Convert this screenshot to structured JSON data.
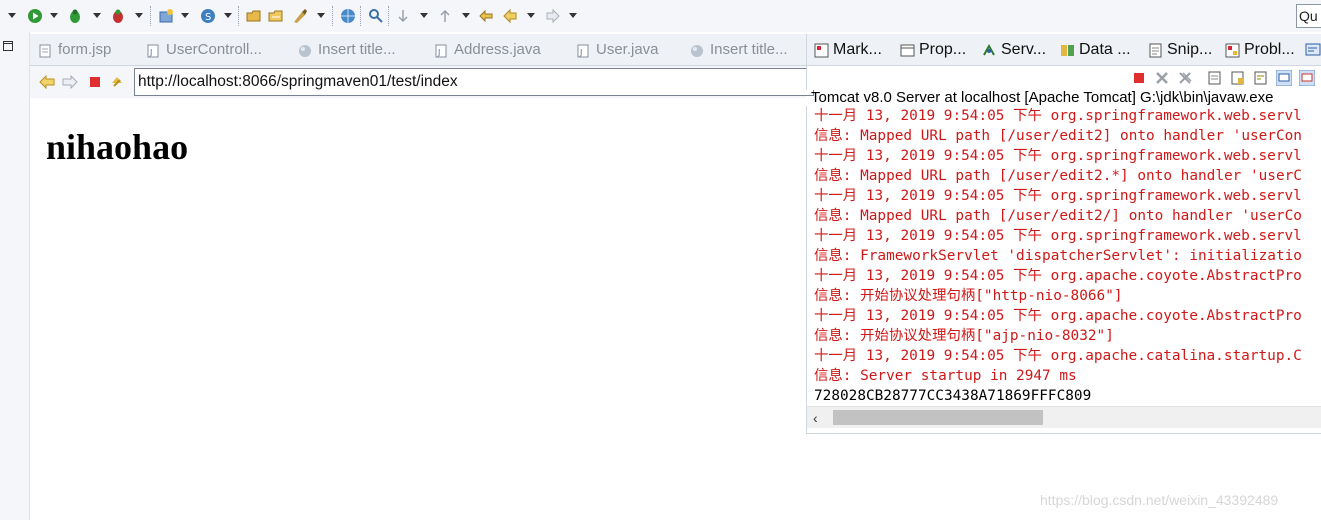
{
  "toolbar": {
    "icons": [
      "new-wizard",
      "run",
      "debug",
      "coverage",
      "external-tools",
      "new-project",
      "new-server",
      "open-type",
      "open-resource",
      "deploy",
      "web-browser",
      "search",
      "next-annotation",
      "prev-annotation",
      "last-edit",
      "back",
      "forward"
    ],
    "quick_access": "Qu"
  },
  "editor": {
    "tabs": [
      {
        "label": "form.jsp",
        "icon": "jsp-file-icon"
      },
      {
        "label": "UserControll...",
        "icon": "java-file-icon"
      },
      {
        "label": "Insert title...",
        "icon": "globe-icon"
      },
      {
        "label": "Address.java",
        "icon": "java-file-icon"
      },
      {
        "label": "User.java",
        "icon": "java-file-icon"
      },
      {
        "label": "Insert title...",
        "icon": "globe-icon"
      }
    ],
    "browser": {
      "url": "http://localhost:8066/springmaven01/test/index"
    },
    "page_heading": "nihaohao"
  },
  "views": {
    "tabs": [
      {
        "label": "Mark...",
        "icon": "markers-icon"
      },
      {
        "label": "Prop...",
        "icon": "properties-icon"
      },
      {
        "label": "Serv...",
        "icon": "servers-icon"
      },
      {
        "label": "Data ...",
        "icon": "data-source-icon"
      },
      {
        "label": "Snip...",
        "icon": "snippets-icon"
      },
      {
        "label": "Probl...",
        "icon": "problems-icon"
      }
    ]
  },
  "console": {
    "label": "Tomcat v8.0 Server at localhost [Apache Tomcat] G:\\jdk\\bin\\javaw.exe",
    "lines": [
      {
        "text": "十一月 13, 2019 9:54:05 下午 org.springframework.web.servl",
        "color": "red"
      },
      {
        "text": "信息: Mapped URL path [/user/edit2] onto handler 'userCon",
        "color": "red"
      },
      {
        "text": "十一月 13, 2019 9:54:05 下午 org.springframework.web.servl",
        "color": "red"
      },
      {
        "text": "信息: Mapped URL path [/user/edit2.*] onto handler 'userC",
        "color": "red"
      },
      {
        "text": "十一月 13, 2019 9:54:05 下午 org.springframework.web.servl",
        "color": "red"
      },
      {
        "text": "信息: Mapped URL path [/user/edit2/] onto handler 'userCo",
        "color": "red"
      },
      {
        "text": "十一月 13, 2019 9:54:05 下午 org.springframework.web.servl",
        "color": "red"
      },
      {
        "text": "信息: FrameworkServlet 'dispatcherServlet': initializatio",
        "color": "red"
      },
      {
        "text": "十一月 13, 2019 9:54:05 下午 org.apache.coyote.AbstractPro",
        "color": "red"
      },
      {
        "text": "信息: 开始协议处理句柄[\"http-nio-8066\"]",
        "color": "red"
      },
      {
        "text": "十一月 13, 2019 9:54:05 下午 org.apache.coyote.AbstractPro",
        "color": "red"
      },
      {
        "text": "信息: 开始协议处理句柄[\"ajp-nio-8032\"]",
        "color": "red"
      },
      {
        "text": "十一月 13, 2019 9:54:05 下午 org.apache.catalina.startup.C",
        "color": "red"
      },
      {
        "text": "信息: Server startup in 2947 ms",
        "color": "red"
      },
      {
        "text": "728028CB28777CC3438A71869FFFC809",
        "color": "black"
      }
    ]
  },
  "watermark": "https://blog.csdn.net/weixin_43392489",
  "colors": {
    "console_error": "#d01818",
    "chrome_bg": "#f4f6fa",
    "tab_bg": "#eef1f6"
  }
}
